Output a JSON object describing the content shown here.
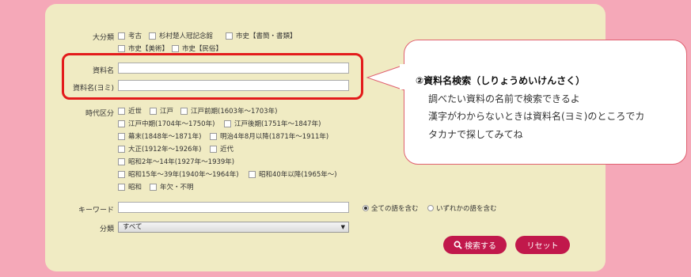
{
  "form": {
    "category_label": "大分類",
    "category_options": [
      "考古",
      "杉村楚人冠記念館",
      "市史【書簡・書類】",
      "市史【美術】",
      "市史【民俗】"
    ],
    "name_label": "資料名",
    "name_value": "",
    "reading_label": "資料名(ヨミ)",
    "reading_value": "",
    "era_label": "時代区分",
    "era_options": [
      "近世",
      "江戸",
      "江戸前期(1603年～1703年)",
      "江戸中期(1704年～1750年)",
      "江戸後期(1751年～1847年)",
      "幕末(1848年～1871年)",
      "明治4年8月以降(1871年～1911年)",
      "大正(1912年～1926年)",
      "近代",
      "昭和2年～14年(1927年～1939年)",
      "昭和15年～39年(1940年～1964年)",
      "昭和40年以降(1965年～)",
      "昭和",
      "年欠・不明"
    ],
    "keyword_label": "キーワード",
    "keyword_value": "",
    "radio_all": "全ての語を含む",
    "radio_any": "いずれかの語を含む",
    "radio_selected": "all",
    "bunrui_label": "分類",
    "bunrui_value": "すべて",
    "search_button": "検索する",
    "reset_button": "リセット"
  },
  "callout": {
    "title": "②資料名検索（しりょうめいけんさく）",
    "lines": [
      "調べたい資料の名前で検索できるよ",
      "漢字がわからないときは資料名(ヨミ)のところでカ",
      "タカナで探してみてね"
    ]
  },
  "colors": {
    "background": "#f5a8b8",
    "panel": "#f0ebc3",
    "highlight": "#e31b1b",
    "button": "#c1184b"
  }
}
